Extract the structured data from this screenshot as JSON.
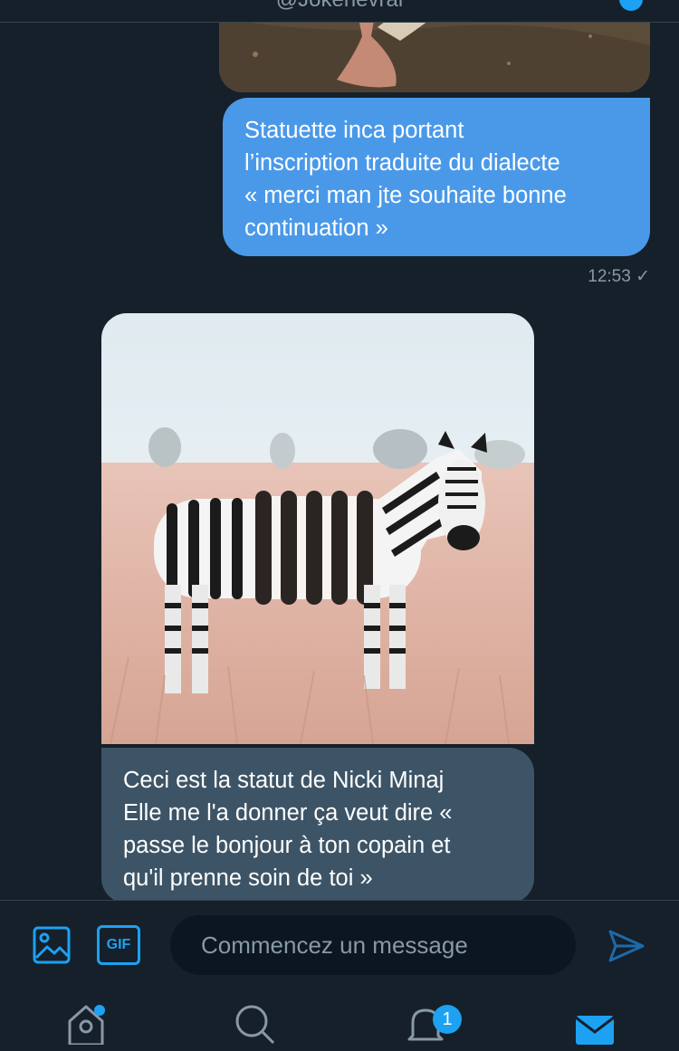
{
  "header": {
    "handle": "@Jokerievrai"
  },
  "messages": [
    {
      "kind": "image",
      "direction": "sent",
      "alt": "photo-partially-visible"
    },
    {
      "kind": "text",
      "direction": "sent",
      "lines": [
        "Statuette inca portant",
        "l’inscription traduite du dialecte",
        "« merci man jte souhaite bonne",
        "continuation »"
      ]
    },
    {
      "kind": "meta",
      "time": "12:53",
      "status": "✓"
    },
    {
      "kind": "image",
      "direction": "received",
      "alt": "zebra-with-oreo-cookies-photo"
    },
    {
      "kind": "text",
      "direction": "received",
      "lines": [
        "Ceci est la statut de Nicki Minaj",
        "Elle me l'a donner ça veut dire  «",
        "passe le bonjour à ton copain et",
        "qu'il prenne soin de toi »"
      ]
    }
  ],
  "composer": {
    "placeholder": "Commencez un message",
    "gif_label": "GIF"
  },
  "nav": {
    "notifications_badge": "1"
  },
  "colors": {
    "background": "#15202b",
    "sent_bubble": "#4a99e9",
    "received_bubble": "#3d5466",
    "accent": "#1da1f2"
  }
}
